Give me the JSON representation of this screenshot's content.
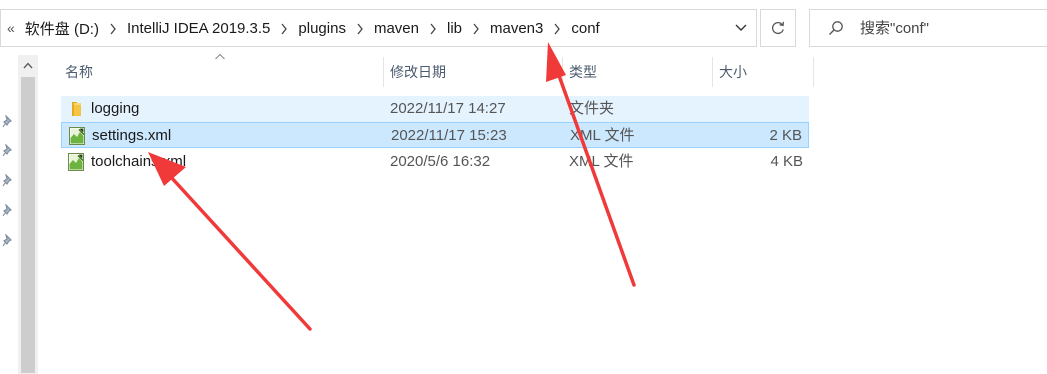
{
  "address_bar": {
    "overflow": "«",
    "crumbs": [
      "软件盘 (D:)",
      "IntelliJ IDEA 2019.3.5",
      "plugins",
      "maven",
      "lib",
      "maven3",
      "conf"
    ]
  },
  "search": {
    "placeholder": "搜索\"conf\""
  },
  "columns": {
    "name": "名称",
    "modified": "修改日期",
    "type": "类型",
    "size": "大小"
  },
  "files": [
    {
      "name": "logging",
      "modified": "2022/11/17 14:27",
      "type": "文件夹",
      "size": "",
      "icon": "folder-icon",
      "state": "hover"
    },
    {
      "name": "settings.xml",
      "modified": "2022/11/17 15:23",
      "type": "XML 文件",
      "size": "2 KB",
      "icon": "xml-file-icon",
      "state": "selected"
    },
    {
      "name": "toolchains.xml",
      "modified": "2020/5/6 16:32",
      "type": "XML 文件",
      "size": "4 KB",
      "icon": "xml-file-icon",
      "state": "normal"
    }
  ],
  "colors": {
    "selection_bg": "#cce8ff",
    "selection_border": "#99d1ff",
    "hover_bg": "#e5f3ff",
    "annotation_arrow": "#f03a3a",
    "folder": "#f5c443"
  }
}
